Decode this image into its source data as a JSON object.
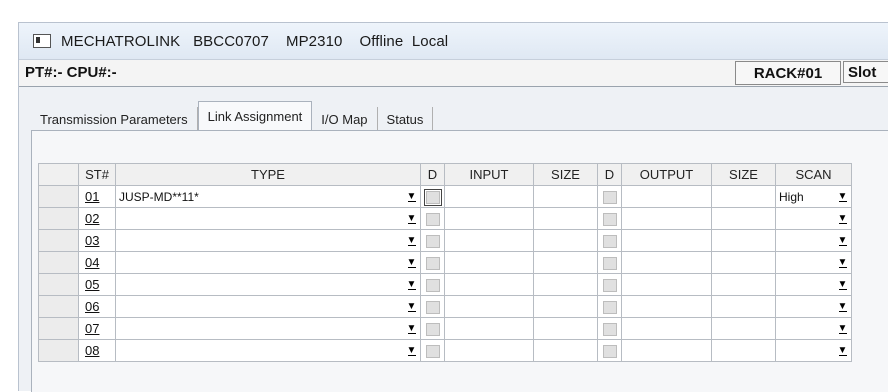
{
  "window": {
    "title": "MECHATROLINK   BBCC0707    MP2310    Offline  Local"
  },
  "status": {
    "pt_cpu": "PT#:- CPU#:-",
    "rack": "RACK#01",
    "slot": "Slot"
  },
  "tabs": [
    {
      "label": "Transmission Parameters",
      "active": false
    },
    {
      "label": "Link Assignment",
      "active": true
    },
    {
      "label": "I/O Map",
      "active": false
    },
    {
      "label": "Status",
      "active": false
    }
  ],
  "grid": {
    "headers": {
      "st": "ST#",
      "type": "TYPE",
      "d1": "D",
      "input": "INPUT",
      "size1": "SIZE",
      "d2": "D",
      "output": "OUTPUT",
      "size2": "SIZE",
      "scan": "SCAN"
    },
    "rows": [
      {
        "st": "01",
        "type": "JUSP-MD**11*",
        "input": "",
        "size1": "",
        "output": "",
        "size2": "",
        "scan": "High"
      },
      {
        "st": "02",
        "type": "",
        "input": "",
        "size1": "",
        "output": "",
        "size2": "",
        "scan": ""
      },
      {
        "st": "03",
        "type": "",
        "input": "",
        "size1": "",
        "output": "",
        "size2": "",
        "scan": ""
      },
      {
        "st": "04",
        "type": "",
        "input": "",
        "size1": "",
        "output": "",
        "size2": "",
        "scan": ""
      },
      {
        "st": "05",
        "type": "",
        "input": "",
        "size1": "",
        "output": "",
        "size2": "",
        "scan": ""
      },
      {
        "st": "06",
        "type": "",
        "input": "",
        "size1": "",
        "output": "",
        "size2": "",
        "scan": ""
      },
      {
        "st": "07",
        "type": "",
        "input": "",
        "size1": "",
        "output": "",
        "size2": "",
        "scan": ""
      },
      {
        "st": "08",
        "type": "",
        "input": "",
        "size1": "",
        "output": "",
        "size2": "",
        "scan": ""
      }
    ]
  },
  "icons": {
    "app": "app-window-icon",
    "dropdown": "chevron-down-icon"
  }
}
